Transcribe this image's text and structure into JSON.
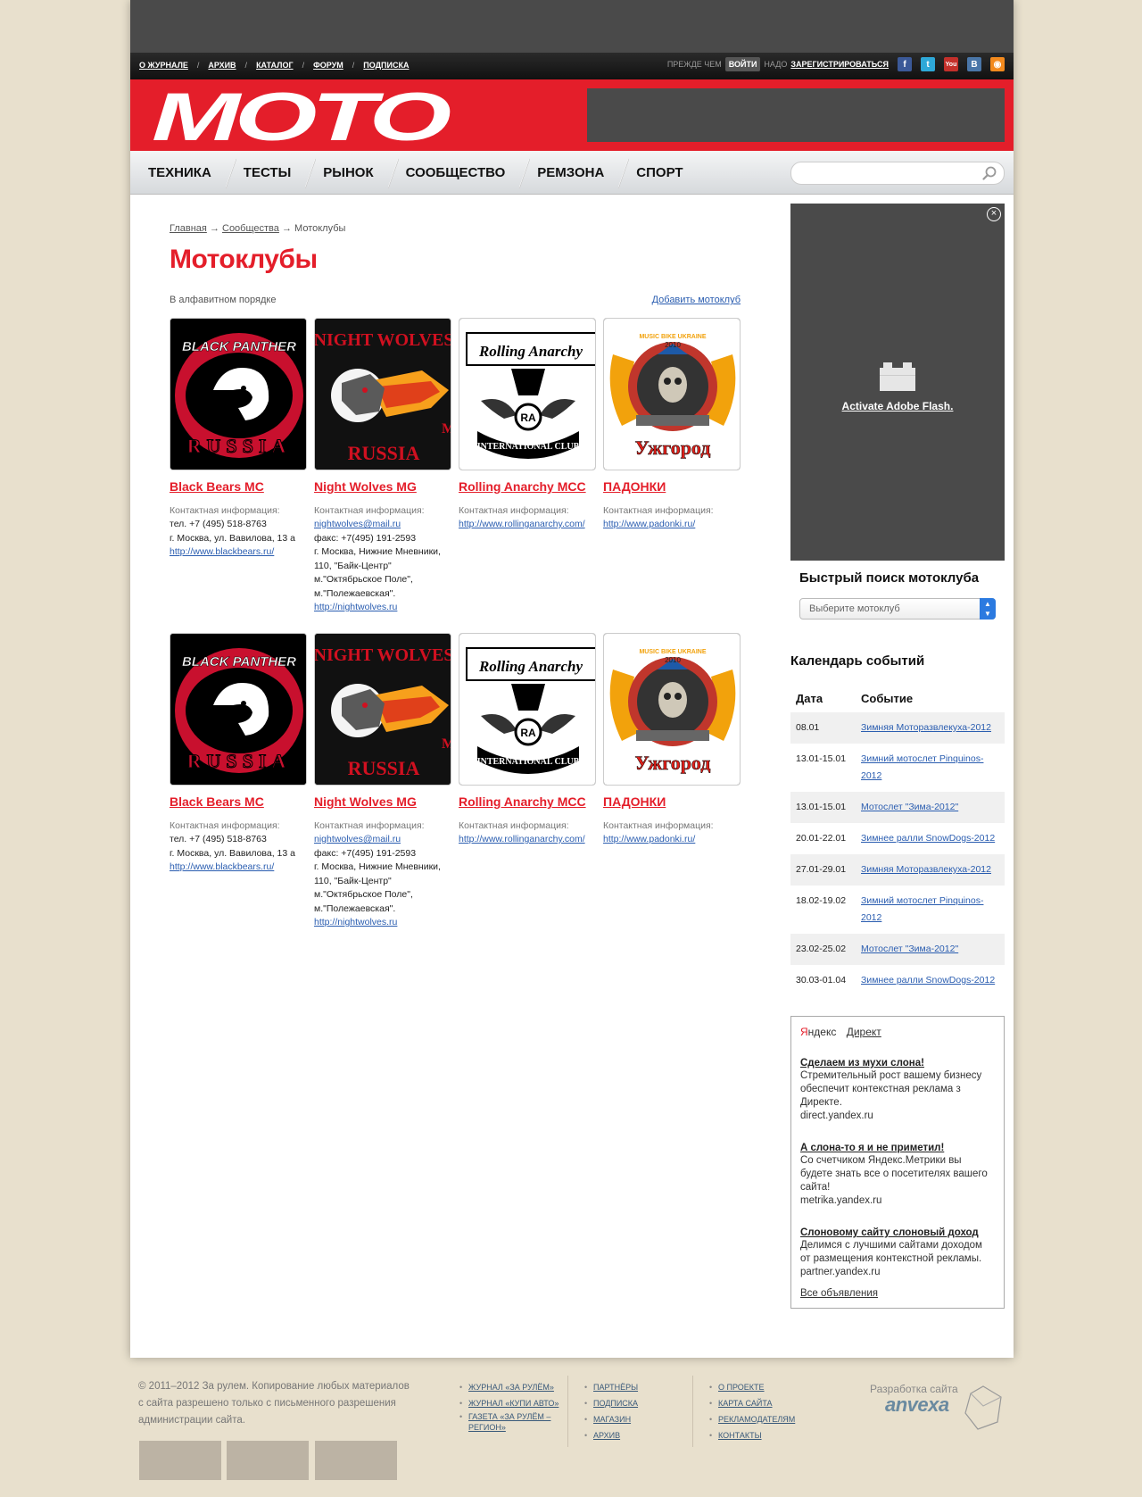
{
  "topnav": [
    "О ЖУРНАЛЕ",
    "АРХИВ",
    "КАТАЛОГ",
    "ФОРУМ",
    "ПОДПИСКА"
  ],
  "auth": {
    "before": "ПРЕЖДЕ ЧЕМ",
    "login": "ВОЙТИ",
    "need": "НАДО",
    "register": "ЗАРЕГИСТРИРОВАТЬСЯ"
  },
  "social": [
    {
      "name": "facebook",
      "glyph": "f",
      "color": "#3b5998"
    },
    {
      "name": "twitter",
      "glyph": "t",
      "color": "#2ea8d8"
    },
    {
      "name": "youtube",
      "glyph": "You",
      "color": "#c4302b"
    },
    {
      "name": "vkontakte",
      "glyph": "B",
      "color": "#4a76a8"
    },
    {
      "name": "rss",
      "glyph": "◉",
      "color": "#f38a1e"
    }
  ],
  "logo_text": "MOTO",
  "mainnav": [
    "ТЕХНИКА",
    "ТЕСТЫ",
    "РЫНОК",
    "СООБЩЕСТВО",
    "РЕМЗОНА",
    "СПОРТ"
  ],
  "breadcrumb": {
    "home": "Главная",
    "community": "Сообщества",
    "current": "Мотоклубы",
    "arrow": "→"
  },
  "page_title": "Мотоклубы",
  "order_label": "В алфавитном порядке",
  "add_club": "Добавить мотоклуб",
  "contact_label": "Контактная информация:",
  "clubs": [
    {
      "name": "Black Bears MC",
      "logo": "panther",
      "lines": [
        "тел. +7 (495) 518-8763",
        "г. Москва, ул. Вавилова, 13 а"
      ],
      "links_before": [],
      "links_after": [
        "http://www.blackbears.ru/"
      ]
    },
    {
      "name": "Night Wolves MG",
      "logo": "wolves",
      "lines": [
        "факс: +7(495) 191-2593",
        "г. Москва, Нижние Мневники,",
        "110, \"Байк-Центр\"",
        "м.\"Октябрьское Поле\",",
        "м.\"Полежаевская\"."
      ],
      "links_before": [
        "nightwolves@mail.ru"
      ],
      "links_after": [
        "http://nightwolves.ru"
      ]
    },
    {
      "name": "Rolling Anarchy MCC",
      "logo": "anarchy",
      "lines": [],
      "links_before": [
        "http://www.rollinganarchy.com/"
      ],
      "links_after": []
    },
    {
      "name": "ПАДОНКИ",
      "logo": "padonki",
      "lines": [],
      "links_before": [
        "http://www.padonki.ru/"
      ],
      "links_after": []
    }
  ],
  "logo_texts": {
    "panther_top": "BLACK PANTHER",
    "panther_bottom": "RUSSIA",
    "wolves_top": "NIGHT WOLVES",
    "wolves_bottom": "RUSSIA",
    "wolves_side": "M",
    "anarchy_top": "Rolling Anarchy",
    "anarchy_mid": "RA",
    "anarchy_bottom": "INTERNATIONAL CLUB",
    "padonki_top": "MUSIC BIKE UKRAINE",
    "padonki_year": "2010",
    "padonki_bottom": "Ужгород"
  },
  "flash_link": "Activate Adobe Flash.",
  "quick_search_title": "Быстрый поиск мотоклуба",
  "club_select_placeholder": "Выберите мотоклуб",
  "calendar": {
    "title": "Календарь событий",
    "headers": [
      "Дата",
      "Событие"
    ],
    "rows": [
      {
        "date": "08.01",
        "event": "Зимняя Моторазвлекуха-2012"
      },
      {
        "date": "13.01-15.01",
        "event": "Зимний мотослет Pinquinos-2012"
      },
      {
        "date": "13.01-15.01",
        "event": "Мотослет \"Зима-2012\""
      },
      {
        "date": "20.01-22.01",
        "event": "Зимнее ралли SnowDogs-2012"
      },
      {
        "date": "27.01-29.01",
        "event": "Зимняя Моторазвлекуха-2012"
      },
      {
        "date": "18.02-19.02",
        "event": "Зимний мотослет Pinquinos-2012"
      },
      {
        "date": "23.02-25.02",
        "event": "Мотослет \"Зима-2012\""
      },
      {
        "date": "30.03-01.04",
        "event": "Зимнее ралли SnowDogs-2012"
      }
    ]
  },
  "direct": {
    "ya_first": "Я",
    "ya_rest": "ндекс",
    "direct_label": "Директ",
    "ads": [
      {
        "title": "Сделаем из мухи слона!",
        "text": "Стремительный рост вашему бизнесу обеспечит контекстная реклама з Директе.",
        "url": "direct.yandex.ru"
      },
      {
        "title": "А слона-то я и не приметил!",
        "text": "Со счетчиком Яндекс.Метрики вы будете знать все о посетителях вашего сайта!",
        "url": "metrika.yandex.ru"
      },
      {
        "title": "Слоновому сайту слоновый доход",
        "text": "Делимся с лучшими сайтами доходом от размещения контекстной рекламы.",
        "url": "partner.yandex.ru"
      }
    ],
    "all_ads": "Все объявления"
  },
  "footer": {
    "copyright": "© 2011–2012 За рулем. Копирование любых материалов с сайта разрешено только с письменного разрешения администрации сайта.",
    "col1": [
      "ЖУРНАЛ «ЗА РУЛЁМ»",
      "ЖУРНАЛ «КУПИ АВТО»",
      "ГАЗЕТА «ЗА РУЛЁМ –",
      "РЕГИОН»"
    ],
    "col2": [
      "ПАРТНЁРЫ",
      "ПОДПИСКА",
      "МАГАЗИН",
      "АРХИВ"
    ],
    "col3": [
      "О ПРОЕКТЕ",
      "КАРТА САЙТА",
      "РЕКЛАМОДАТЕЛЯМ",
      "КОНТАКТЫ"
    ],
    "dev_label": "Разработка сайта",
    "dev_brand": "anvexa"
  },
  "colors": {
    "brand_red": "#e41e2a",
    "banner_gray": "#4a4a4a",
    "page_bg": "#e8e0cd"
  }
}
